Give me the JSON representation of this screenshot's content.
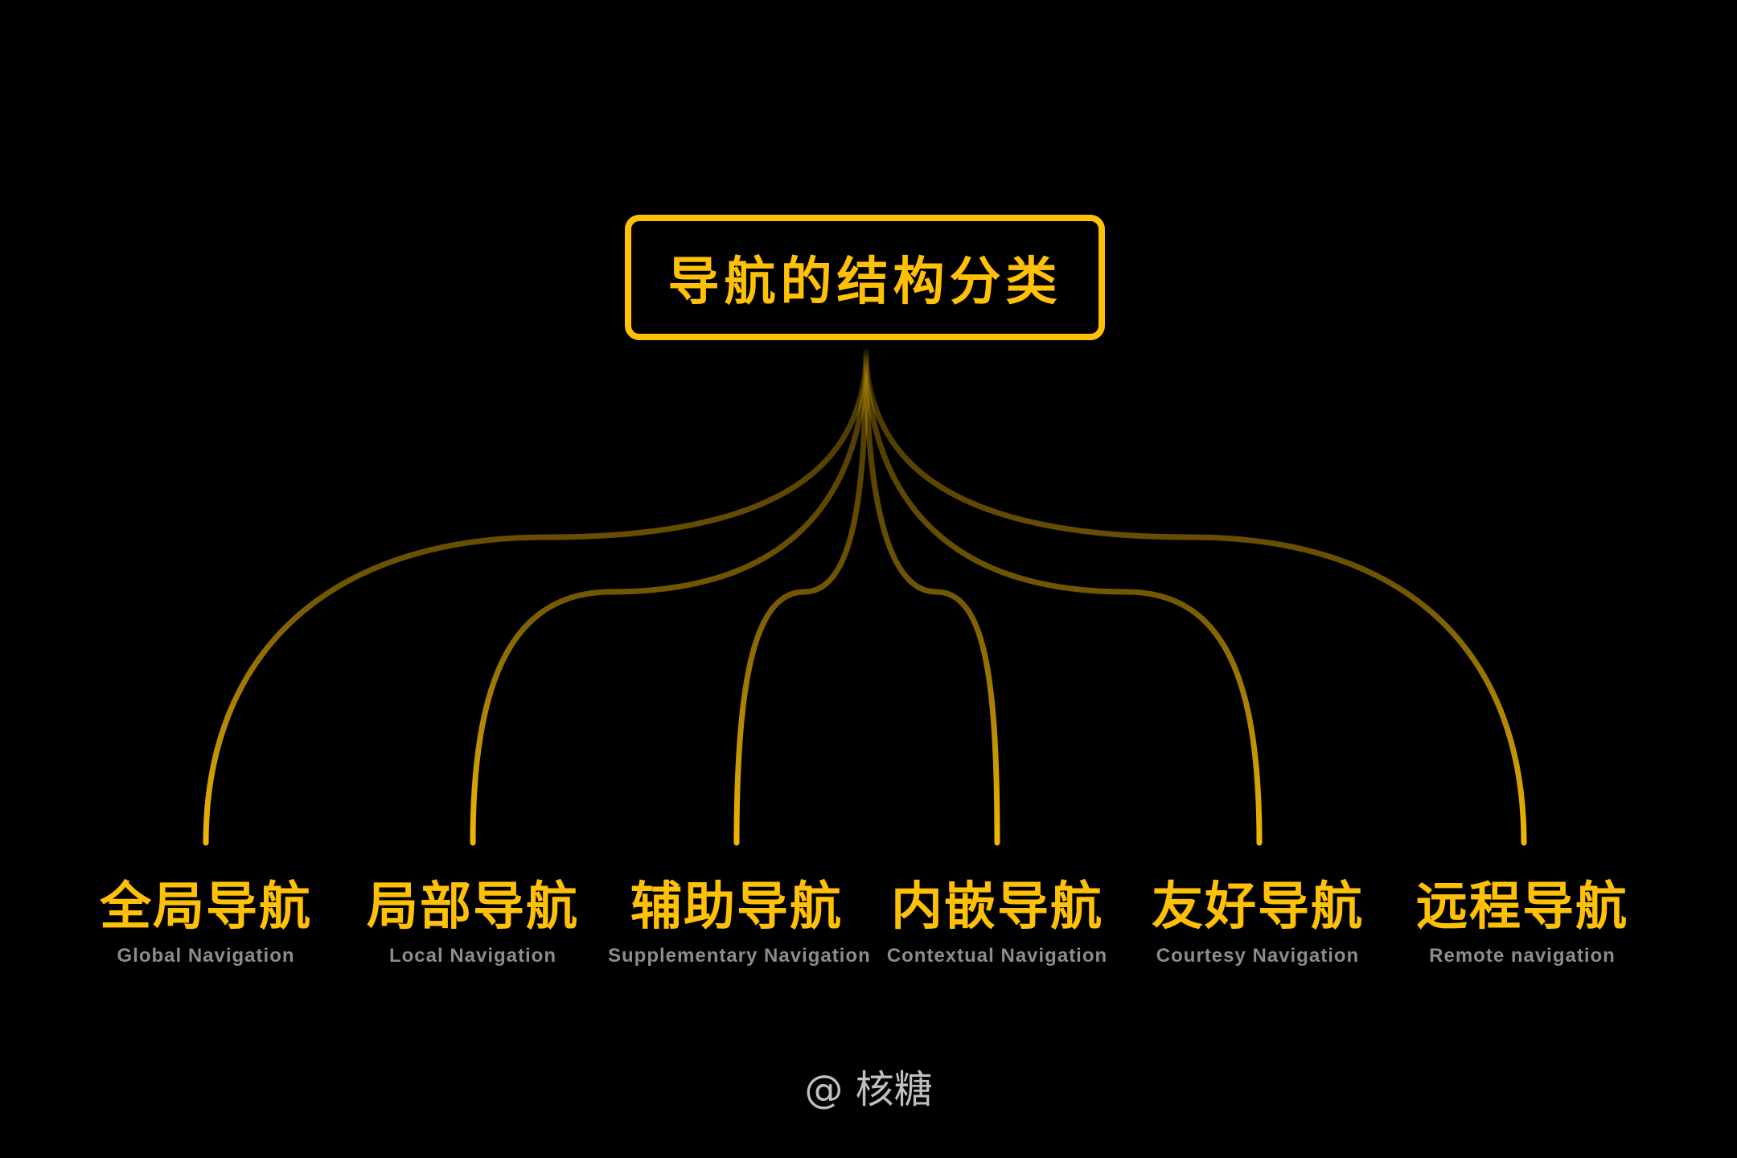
{
  "root": {
    "title": "导航的结构分类"
  },
  "branches": [
    {
      "title": "全局导航",
      "subtitle": "Global Navigation"
    },
    {
      "title": "局部导航",
      "subtitle": "Local Navigation"
    },
    {
      "title": "辅助导航",
      "subtitle": "Supplementary Navigation"
    },
    {
      "title": "内嵌导航",
      "subtitle": "Contextual Navigation"
    },
    {
      "title": "友好导航",
      "subtitle": "Courtesy Navigation"
    },
    {
      "title": "远程导航",
      "subtitle": "Remote navigation"
    }
  ],
  "watermark": "@ 核糖",
  "colors": {
    "background": "#000000",
    "accent": "#FFC107",
    "subtitle": "#8C8C8C",
    "watermark": "#BFBFBF"
  }
}
